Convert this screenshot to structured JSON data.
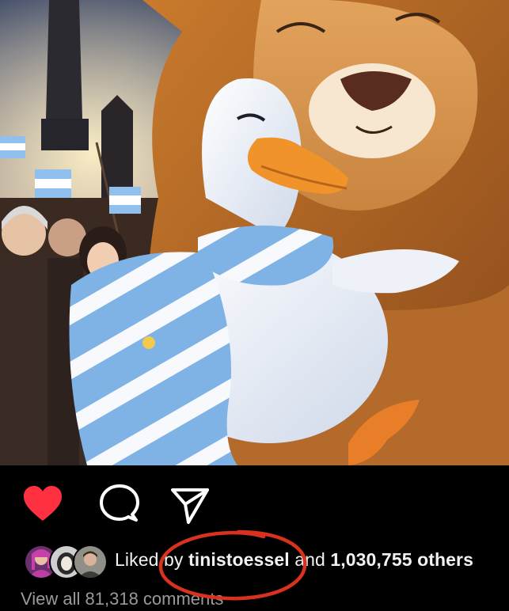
{
  "post": {
    "image_icon": "anime-style illustration of a goose wrapped in an Argentine flag hugging a lion",
    "liked": true,
    "colors": {
      "like_red": "#ff3040",
      "background": "#000000",
      "annotation_red": "#d8321e",
      "text_primary": "#f2f2f2",
      "text_secondary": "#9a9a9a"
    }
  },
  "actions": {
    "like_icon": "heart-filled-icon",
    "comment_icon": "speech-bubble-icon",
    "share_icon": "paper-plane-icon"
  },
  "likes": {
    "prefix": "Liked by ",
    "username": "tinistoessel",
    "middle": " and ",
    "count": "1,030,755 others"
  },
  "comments": {
    "link": "View all 81,318 comments"
  }
}
